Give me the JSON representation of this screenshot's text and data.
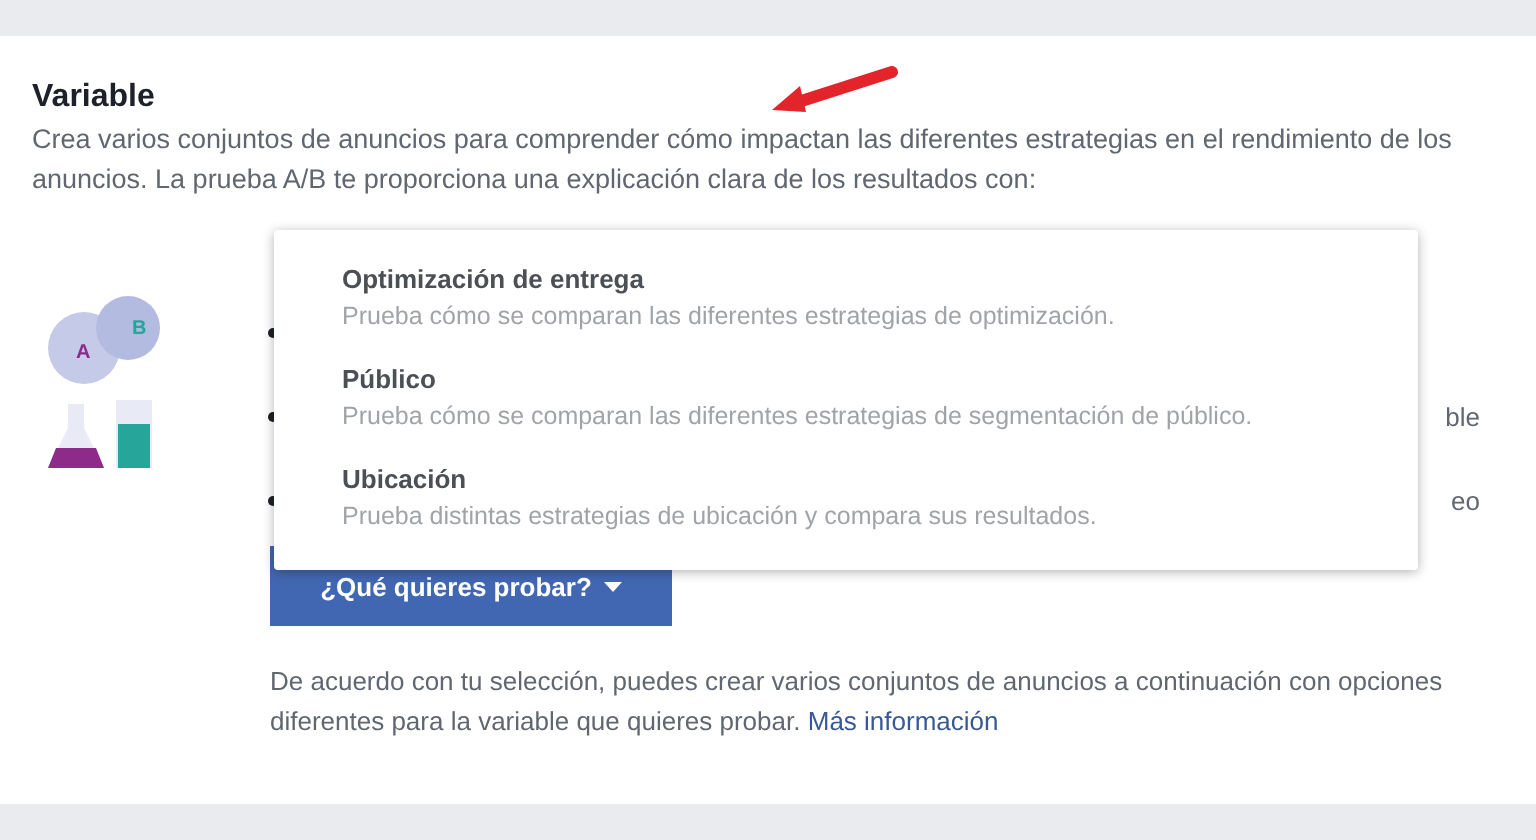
{
  "section": {
    "title": "Variable",
    "description": "Crea varios conjuntos de anuncios para comprender cómo impactan las diferentes estrategias en el rendimiento de los anuncios. La prueba A/B te proporciona una explicación clara de los resultados con:"
  },
  "illustration": {
    "labels": [
      "A",
      "B"
    ]
  },
  "bullets": [
    {
      "kind": "hidden"
    },
    {
      "kind": "tail",
      "text": "ble"
    },
    {
      "kind": "tail",
      "text": "eo"
    }
  ],
  "dropdown": {
    "expanded": true,
    "label": "¿Qué quieres probar?",
    "options": [
      {
        "title": "Optimización de entrega",
        "description": "Prueba cómo se comparan las diferentes estrategias de optimización."
      },
      {
        "title": "Público",
        "description": "Prueba cómo se comparan las diferentes estrategias de segmentación de público."
      },
      {
        "title": "Ubicación",
        "description": "Prueba distintas estrategias de ubicación y compara sus resultados."
      }
    ]
  },
  "footer": {
    "text": "De acuerdo con tu selección, puedes crear varios conjuntos de anuncios a continuación con opciones diferentes para la variable que quieres probar.",
    "link": "Más información"
  }
}
